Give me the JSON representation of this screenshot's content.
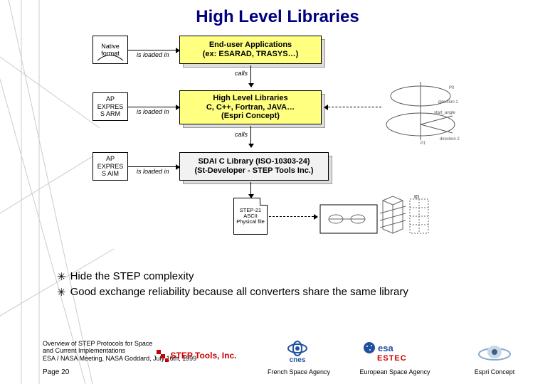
{
  "title": "High Level Libraries",
  "diagram": {
    "native_format": "Native format",
    "end_user_apps_l1": "End-user Applications",
    "end_user_apps_l2": "(ex: ESARAD, TRASYS…)",
    "loaded": "is loaded in",
    "calls": "calls",
    "ap_arm_l1": "AP",
    "ap_arm_l2": "EXPRES",
    "ap_arm_l3": "S ARM",
    "hll_l1": "High Level Libraries",
    "hll_l2": "C, C++, Fortran, JAVA…",
    "hll_l3": "(Espri Concept)",
    "ap_aim_l1": "AP",
    "ap_aim_l2": "EXPRES",
    "ap_aim_l3": "S AIM",
    "sdai_l1": "SDAI C Library (ISO-10303-24)",
    "sdai_l2": "(St-Developer - STEP Tools Inc.)",
    "step21_l1": "STEP-21",
    "step21_l2": "ASCII",
    "step21_l3": "Physical file"
  },
  "bullets": {
    "b1": "Hide the STEP complexity",
    "b2": "Good exchange reliability because all converters share the same library"
  },
  "footer": {
    "overview_l1": "Overview of STEP Protocols for Space",
    "overview_l2": "and Current Implementations",
    "overview_l3": "ESA / NASA Meeting, NASA Goddard, July 16th, 1999",
    "page": "Page 20",
    "steptools": "STEP Tools, Inc.",
    "cnes": "cnes",
    "fsa": "French Space Agency",
    "esa": "esa",
    "estec": "ESTEC",
    "euro": "European Space Agency",
    "espri": "Espri Concept"
  }
}
